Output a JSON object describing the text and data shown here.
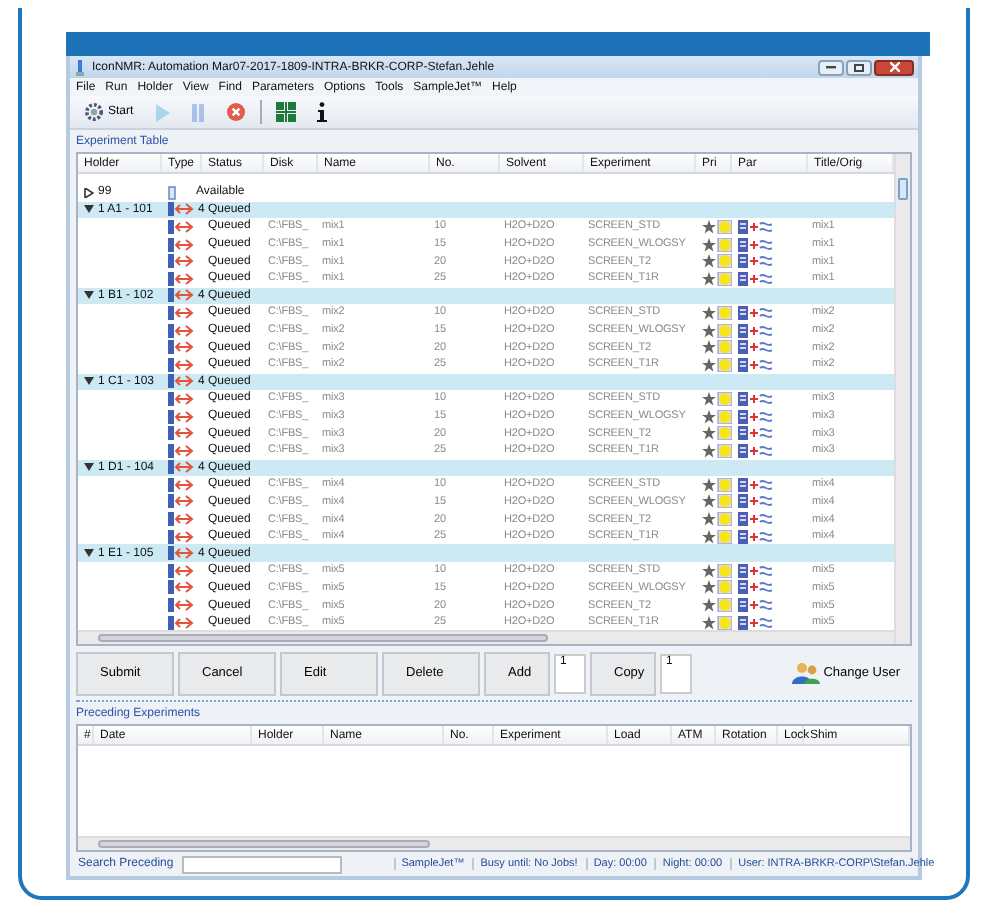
{
  "window": {
    "title": "IconNMR: Automation Mar07-2017-1809-INTRA-BRKR-CORP-Stefan.Jehle"
  },
  "menu": [
    "File",
    "Run",
    "Holder",
    "View",
    "Find",
    "Parameters",
    "Options",
    "Tools",
    "SampleJet™",
    "Help"
  ],
  "toolbar": [
    {
      "kind": "start",
      "label": "Start",
      "disabled": false
    },
    {
      "kind": "play",
      "disabled": true
    },
    {
      "kind": "pause",
      "disabled": true
    },
    {
      "kind": "stop",
      "disabled": false
    },
    {
      "kind": "grid",
      "disabled": false
    },
    {
      "kind": "info",
      "disabled": false
    }
  ],
  "experiment_table": {
    "title": "Experiment Table",
    "columns": [
      "Holder",
      "Type",
      "Status",
      "Disk",
      "Name",
      "No.",
      "Solvent",
      "Experiment",
      "Pri",
      "Par",
      "Title/Orig"
    ],
    "holders": [
      {
        "holder": "99",
        "kind": "available",
        "status": "Available",
        "expanded": false
      },
      {
        "holder": "1  A1 - 101",
        "kind": "queued",
        "status": "4 Queued",
        "expanded": true,
        "children": [
          {
            "status": "Queued",
            "disk": "C:\\FBS_",
            "name": "mix1",
            "no": "10",
            "solvent": "H2O+D2O",
            "experiment": "SCREEN_STD",
            "title": "mix1"
          },
          {
            "status": "Queued",
            "disk": "C:\\FBS_",
            "name": "mix1",
            "no": "15",
            "solvent": "H2O+D2O",
            "experiment": "SCREEN_WLOGSY",
            "title": "mix1"
          },
          {
            "status": "Queued",
            "disk": "C:\\FBS_",
            "name": "mix1",
            "no": "20",
            "solvent": "H2O+D2O",
            "experiment": "SCREEN_T2",
            "title": "mix1"
          },
          {
            "status": "Queued",
            "disk": "C:\\FBS_",
            "name": "mix1",
            "no": "25",
            "solvent": "H2O+D2O",
            "experiment": "SCREEN_T1R",
            "title": "mix1"
          }
        ]
      },
      {
        "holder": "1  B1 - 102",
        "kind": "queued",
        "status": "4 Queued",
        "expanded": true,
        "children": [
          {
            "status": "Queued",
            "disk": "C:\\FBS_",
            "name": "mix2",
            "no": "10",
            "solvent": "H2O+D2O",
            "experiment": "SCREEN_STD",
            "title": "mix2"
          },
          {
            "status": "Queued",
            "disk": "C:\\FBS_",
            "name": "mix2",
            "no": "15",
            "solvent": "H2O+D2O",
            "experiment": "SCREEN_WLOGSY",
            "title": "mix2"
          },
          {
            "status": "Queued",
            "disk": "C:\\FBS_",
            "name": "mix2",
            "no": "20",
            "solvent": "H2O+D2O",
            "experiment": "SCREEN_T2",
            "title": "mix2"
          },
          {
            "status": "Queued",
            "disk": "C:\\FBS_",
            "name": "mix2",
            "no": "25",
            "solvent": "H2O+D2O",
            "experiment": "SCREEN_T1R",
            "title": "mix2"
          }
        ]
      },
      {
        "holder": "1  C1 - 103",
        "kind": "queued",
        "status": "4 Queued",
        "expanded": true,
        "children": [
          {
            "status": "Queued",
            "disk": "C:\\FBS_",
            "name": "mix3",
            "no": "10",
            "solvent": "H2O+D2O",
            "experiment": "SCREEN_STD",
            "title": "mix3"
          },
          {
            "status": "Queued",
            "disk": "C:\\FBS_",
            "name": "mix3",
            "no": "15",
            "solvent": "H2O+D2O",
            "experiment": "SCREEN_WLOGSY",
            "title": "mix3"
          },
          {
            "status": "Queued",
            "disk": "C:\\FBS_",
            "name": "mix3",
            "no": "20",
            "solvent": "H2O+D2O",
            "experiment": "SCREEN_T2",
            "title": "mix3"
          },
          {
            "status": "Queued",
            "disk": "C:\\FBS_",
            "name": "mix3",
            "no": "25",
            "solvent": "H2O+D2O",
            "experiment": "SCREEN_T1R",
            "title": "mix3"
          }
        ]
      },
      {
        "holder": "1  D1 - 104",
        "kind": "queued",
        "status": "4 Queued",
        "expanded": true,
        "children": [
          {
            "status": "Queued",
            "disk": "C:\\FBS_",
            "name": "mix4",
            "no": "10",
            "solvent": "H2O+D2O",
            "experiment": "SCREEN_STD",
            "title": "mix4"
          },
          {
            "status": "Queued",
            "disk": "C:\\FBS_",
            "name": "mix4",
            "no": "15",
            "solvent": "H2O+D2O",
            "experiment": "SCREEN_WLOGSY",
            "title": "mix4"
          },
          {
            "status": "Queued",
            "disk": "C:\\FBS_",
            "name": "mix4",
            "no": "20",
            "solvent": "H2O+D2O",
            "experiment": "SCREEN_T2",
            "title": "mix4"
          },
          {
            "status": "Queued",
            "disk": "C:\\FBS_",
            "name": "mix4",
            "no": "25",
            "solvent": "H2O+D2O",
            "experiment": "SCREEN_T1R",
            "title": "mix4"
          }
        ]
      },
      {
        "holder": "1  E1 - 105",
        "kind": "queued",
        "status": "4 Queued",
        "expanded": true,
        "children": [
          {
            "status": "Queued",
            "disk": "C:\\FBS_",
            "name": "mix5",
            "no": "10",
            "solvent": "H2O+D2O",
            "experiment": "SCREEN_STD",
            "title": "mix5"
          },
          {
            "status": "Queued",
            "disk": "C:\\FBS_",
            "name": "mix5",
            "no": "15",
            "solvent": "H2O+D2O",
            "experiment": "SCREEN_WLOGSY",
            "title": "mix5"
          },
          {
            "status": "Queued",
            "disk": "C:\\FBS_",
            "name": "mix5",
            "no": "20",
            "solvent": "H2O+D2O",
            "experiment": "SCREEN_T2",
            "title": "mix5"
          },
          {
            "status": "Queued",
            "disk": "C:\\FBS_",
            "name": "mix5",
            "no": "25",
            "solvent": "H2O+D2O",
            "experiment": "SCREEN_T1R",
            "title": "mix5"
          }
        ]
      }
    ]
  },
  "buttons": [
    {
      "kind": "button",
      "label": "Submit"
    },
    {
      "kind": "button",
      "label": "Cancel"
    },
    {
      "kind": "button",
      "label": "Edit"
    },
    {
      "kind": "button",
      "label": "Delete"
    },
    {
      "kind": "spin",
      "label": "Add",
      "value": "1"
    },
    {
      "kind": "spin",
      "label": "Copy",
      "value": "1"
    }
  ],
  "change_user": {
    "label": "Change User"
  },
  "preceding": {
    "title": "Preceding Experiments",
    "columns": [
      "#",
      "Date",
      "Holder",
      "Name",
      "No.",
      "Experiment",
      "Load",
      "ATM",
      "Rotation",
      "Lock",
      "Shim"
    ]
  },
  "status_bar": {
    "search_label": "Search Preceding",
    "samplejet": "SampleJet™",
    "busy": "Busy until:  No Jobs!",
    "day": "Day: 00:00",
    "night": "Night: 00:00",
    "user": "User: INTRA-BRKR-CORP\\Stefan.Jehle"
  }
}
